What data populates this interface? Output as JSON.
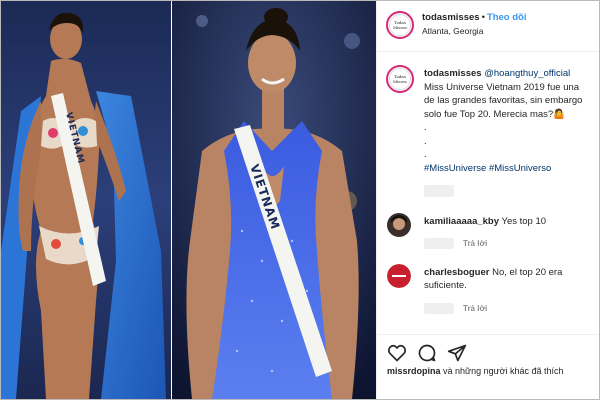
{
  "post": {
    "username": "todasmisses",
    "follow_label": "Theo dõi",
    "location": "Atlanta, Georgia",
    "avatar_text": "Todas Misses",
    "sash_text": "VIETNAM"
  },
  "caption": {
    "username": "todasmisses",
    "mention": "@hoangthuy_official",
    "lines": [
      "Miss Universe Vietnam 2019 fue una",
      "de las grandes favoritas, sin embargo",
      "solo fue Top 20. Merecia mas?🤷",
      ".",
      ".",
      "."
    ],
    "hashtags": [
      "#MissUniverse",
      "#MissUniverso"
    ]
  },
  "comments": [
    {
      "username": "kamiliaaaaa_kby",
      "text": "Yes top 10",
      "reply": "Trả lời"
    },
    {
      "username": "charlesboguer",
      "text": "No, el top 20 era suficiente.",
      "reply": "Trả lời"
    }
  ],
  "likes": {
    "username": "missrdopina",
    "text": "và những người khác đã thích"
  },
  "icons": [
    "heart-icon",
    "comment-icon",
    "share-icon"
  ],
  "colors": {
    "link": "#3897f0",
    "hashtag": "#00376b",
    "gown": "#2f4fcf",
    "cape": "#2b6fd1"
  }
}
